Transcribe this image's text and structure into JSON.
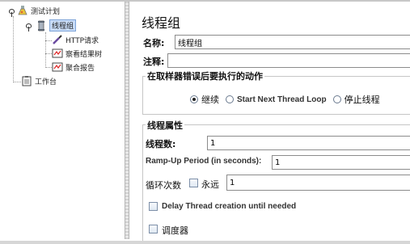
{
  "tree": {
    "test_plan": "测试计划",
    "thread_group": "线程组",
    "http_request": "HTTP请求",
    "results_tree": "察看结果树",
    "aggregate_report": "聚合报告",
    "workbench": "工作台"
  },
  "panel": {
    "title": "线程组",
    "name_label": "名称:",
    "name_value": "线程组",
    "comment_label": "注释:",
    "comment_value": "",
    "error_group": {
      "title": "在取样器错误后要执行的动作",
      "options": [
        "继续",
        "Start Next Thread Loop",
        "停止线程"
      ],
      "selected": "继续"
    },
    "thread_props": {
      "title": "线程属性",
      "threads_label": "线程数:",
      "threads_value": "1",
      "rampup_label": "Ramp-Up Period (in seconds):",
      "rampup_value": "1",
      "loop_label": "循环次数",
      "forever_label": "永远",
      "forever_checked": false,
      "loop_value": "1",
      "delay_label": "Delay Thread creation until needed",
      "delay_checked": false,
      "scheduler_label": "调度器",
      "scheduler_checked": false
    }
  },
  "colors": {
    "selection_bg": "#c8dcf8",
    "selection_border": "#7ea4d8"
  }
}
